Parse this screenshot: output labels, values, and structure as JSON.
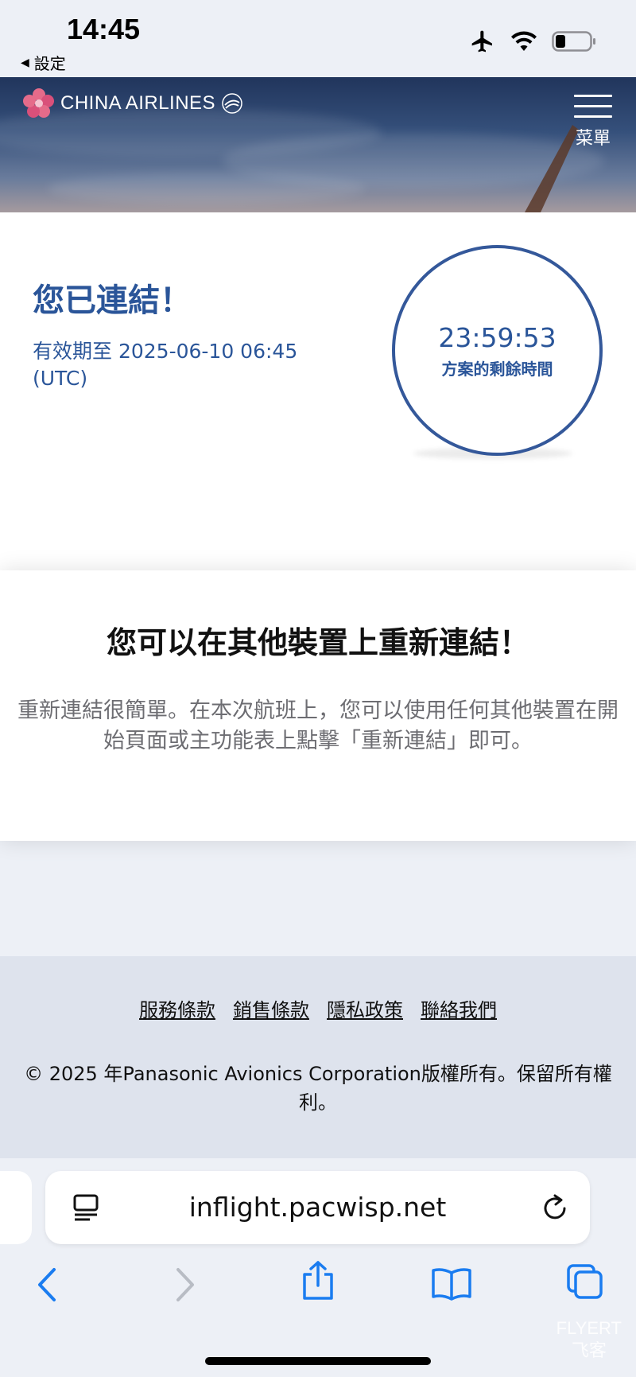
{
  "status_bar": {
    "time": "14:45",
    "back_app": "設定",
    "icons": [
      "airplane-icon",
      "wifi-icon",
      "battery-icon"
    ]
  },
  "header": {
    "logo_text": "CHINA AIRLINES",
    "menu_label": "菜單"
  },
  "connected": {
    "title": "您已連結！",
    "valid_until": "有效期至 2025-06-10 06:45 (UTC)",
    "timer_value": "23:59:53",
    "timer_label": "方案的剩餘時間"
  },
  "reconnect": {
    "title": "您可以在其他裝置上重新連結！",
    "body": "重新連結很簡單。在本次航班上，您可以使用任何其他裝置在開始頁面或主功能表上點擊「重新連結」即可。"
  },
  "footer": {
    "links": [
      "服務條款",
      "銷售條款",
      "隱私政策",
      "聯絡我們"
    ],
    "copyright": "© 2025 年Panasonic Avionics Corporation版權所有。保留所有權利。"
  },
  "browser": {
    "url": "inflight.pacwisp.net"
  },
  "watermark": {
    "line1": "FLYERT",
    "line2": "飞客"
  },
  "colors": {
    "brand_blue": "#2a5599",
    "ios_blue": "#1a7cf0",
    "page_bg": "#edf0f6",
    "footer_bg": "#dee3ed"
  }
}
